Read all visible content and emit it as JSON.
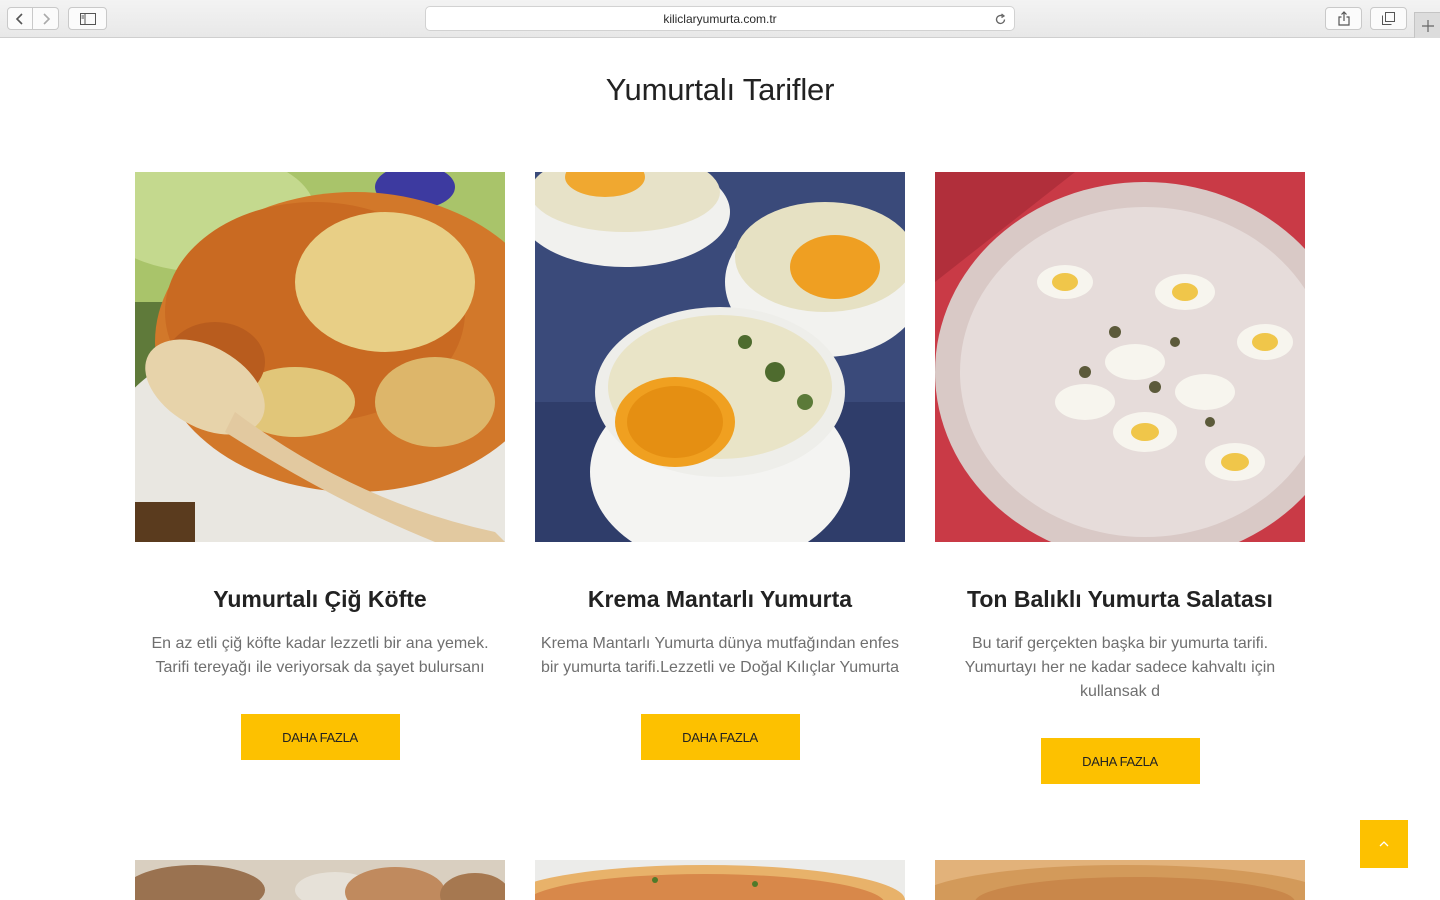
{
  "browser": {
    "url": "kiliclaryumurta.com.tr"
  },
  "page": {
    "title": "Yumurtalı Tarifler"
  },
  "recipes": [
    {
      "title": "Yumurtalı Çiğ Köfte",
      "excerpt": "En az etli çiğ köfte kadar lezzetli bir ana yemek. Tarifi tereyağı ile veriyorsak da şayet bulursanı",
      "button": "DAHA FAZLA"
    },
    {
      "title": "Krema Mantarlı Yumurta",
      "excerpt": "Krema Mantarlı Yumurta dünya mutfağından enfes bir yumurta tarifi.Lezzetli ve Doğal Kılıçlar Yumurta",
      "button": "DAHA FAZLA"
    },
    {
      "title": "Ton Balıklı Yumurta Salatası",
      "excerpt": "Bu tarif gerçekten başka bir yumurta tarifi. Yumurtayı her ne kadar sadece kahvaltı için kullansak d",
      "button": "DAHA FAZLA"
    }
  ],
  "colors": {
    "accent": "#fdc100",
    "title_text": "#222222",
    "body_text": "#6f6f6f"
  }
}
